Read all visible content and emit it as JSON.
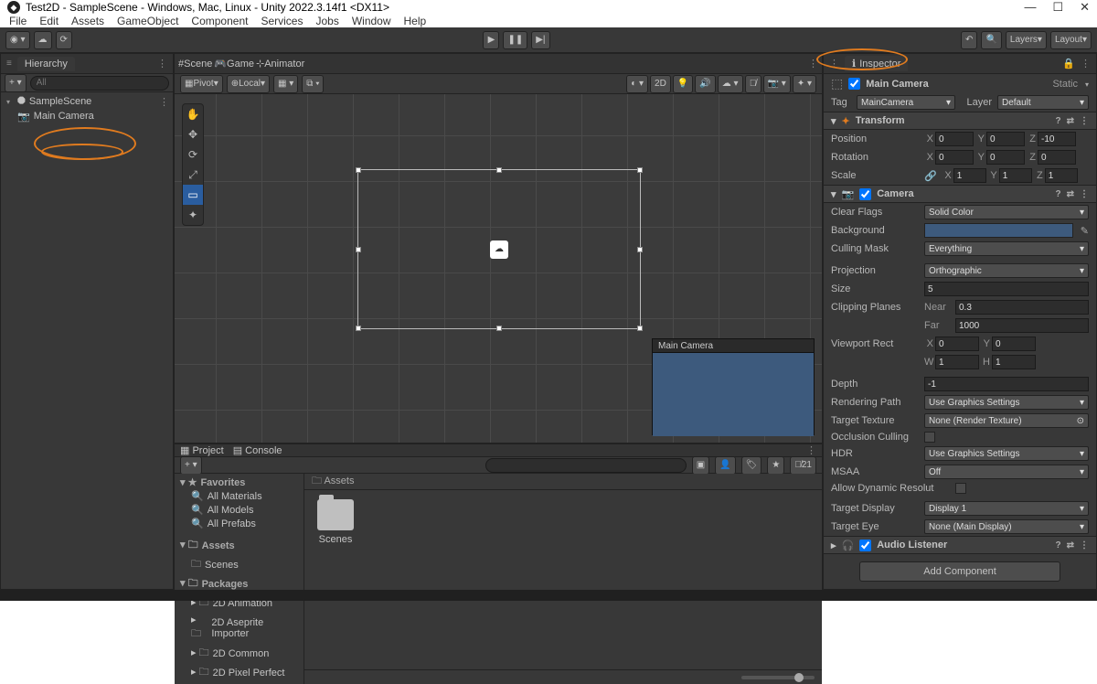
{
  "window": {
    "title": "Test2D - SampleScene - Windows, Mac, Linux - Unity 2022.3.14f1 <DX11>"
  },
  "menu": [
    "File",
    "Edit",
    "Assets",
    "GameObject",
    "Component",
    "Services",
    "Jobs",
    "Window",
    "Help"
  ],
  "topbar": {
    "layers": "Layers",
    "layout": "Layout"
  },
  "hierarchy": {
    "tab": "Hierarchy",
    "search_placeholder": "All",
    "scene": "SampleScene",
    "items": [
      "Main Camera"
    ]
  },
  "scene_tabs": {
    "scene": "Scene",
    "game": "Game",
    "animator": "Animator"
  },
  "scene_toolbar": {
    "pivot": "Pivot",
    "local": "Local",
    "two_d": "2D"
  },
  "preview_title": "Main Camera",
  "inspector": {
    "tab": "Inspector",
    "object_name": "Main Camera",
    "static_label": "Static",
    "tag_label": "Tag",
    "tag_value": "MainCamera",
    "layer_label": "Layer",
    "layer_value": "Default",
    "transform": {
      "title": "Transform",
      "position": {
        "label": "Position",
        "x": "0",
        "y": "0",
        "z": "-10"
      },
      "rotation": {
        "label": "Rotation",
        "x": "0",
        "y": "0",
        "z": "0"
      },
      "scale": {
        "label": "Scale",
        "x": "1",
        "y": "1",
        "z": "1"
      }
    },
    "camera": {
      "title": "Camera",
      "clear_flags": {
        "label": "Clear Flags",
        "value": "Solid Color"
      },
      "background_label": "Background",
      "culling_mask": {
        "label": "Culling Mask",
        "value": "Everything"
      },
      "projection": {
        "label": "Projection",
        "value": "Orthographic"
      },
      "size": {
        "label": "Size",
        "value": "5"
      },
      "clipping": {
        "label": "Clipping Planes",
        "near_label": "Near",
        "near": "0.3",
        "far_label": "Far",
        "far": "1000"
      },
      "viewport": {
        "label": "Viewport Rect",
        "x": "0",
        "y": "0",
        "w": "1",
        "h": "1"
      },
      "depth": {
        "label": "Depth",
        "value": "-1"
      },
      "rendering_path": {
        "label": "Rendering Path",
        "value": "Use Graphics Settings"
      },
      "target_texture": {
        "label": "Target Texture",
        "value": "None (Render Texture)"
      },
      "occlusion_label": "Occlusion Culling",
      "hdr": {
        "label": "HDR",
        "value": "Use Graphics Settings"
      },
      "msaa": {
        "label": "MSAA",
        "value": "Off"
      },
      "allow_dynamic_label": "Allow Dynamic Resolut",
      "target_display": {
        "label": "Target Display",
        "value": "Display 1"
      },
      "target_eye": {
        "label": "Target Eye",
        "value": "None (Main Display)"
      }
    },
    "audio_listener_title": "Audio Listener",
    "add_component": "Add Component"
  },
  "project": {
    "tab_project": "Project",
    "tab_console": "Console",
    "favorites": "Favorites",
    "fav_items": [
      "All Materials",
      "All Models",
      "All Prefabs"
    ],
    "assets_hdr": "Assets",
    "assets_children": [
      "Scenes"
    ],
    "packages_hdr": "Packages",
    "packages_children": [
      "2D Animation",
      "2D Aseprite Importer",
      "2D Common",
      "2D Pixel Perfect"
    ],
    "breadcrumb": "Assets",
    "folder_scenes": "Scenes",
    "icon_count": "21"
  }
}
